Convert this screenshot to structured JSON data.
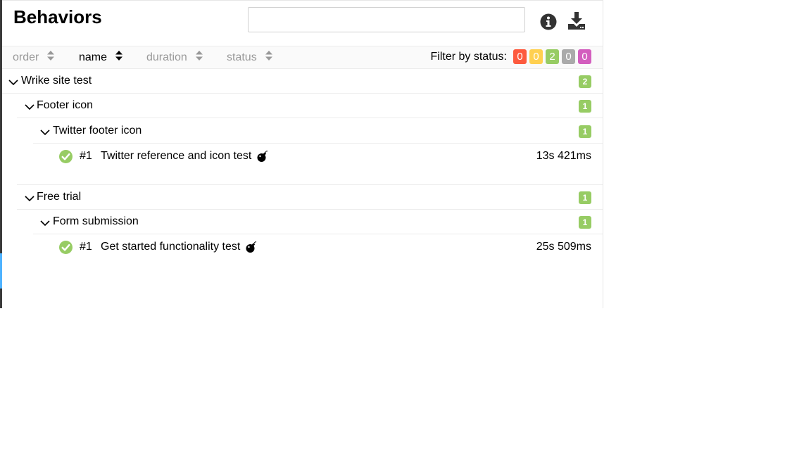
{
  "header": {
    "title": "Behaviors",
    "search_value": "",
    "search_placeholder": ""
  },
  "icons": {
    "info": "info-circle-icon",
    "download": "download-icon"
  },
  "sorters": {
    "order": "order",
    "name": "name",
    "duration": "duration",
    "status": "status",
    "active": "name"
  },
  "filter": {
    "label": "Filter by status:",
    "badges": [
      {
        "status": "failed",
        "count": "0",
        "color": "#fd5a3e"
      },
      {
        "status": "broken",
        "count": "0",
        "color": "#ffd050"
      },
      {
        "status": "passed",
        "count": "2",
        "color": "#97cc64"
      },
      {
        "status": "skipped",
        "count": "0",
        "color": "#aaaaaa"
      },
      {
        "status": "unknown",
        "count": "0",
        "color": "#d35ebe"
      }
    ]
  },
  "tree": {
    "epic": {
      "label": "Wrike site test",
      "count": "2"
    },
    "feature1": {
      "label": "Footer icon",
      "count": "1"
    },
    "story1": {
      "label": "Twitter footer icon",
      "count": "1"
    },
    "test1": {
      "num": "#1",
      "name": "Twitter reference and icon test",
      "duration": "13s 421ms"
    },
    "feature2": {
      "label": "Free trial",
      "count": "1"
    },
    "story2": {
      "label": "Form submission",
      "count": "1"
    },
    "test2": {
      "num": "#1",
      "name": "Get started functionality test",
      "duration": "25s 509ms"
    }
  },
  "colors": {
    "passed": "#97cc64",
    "accent": "#4fb3ff"
  }
}
